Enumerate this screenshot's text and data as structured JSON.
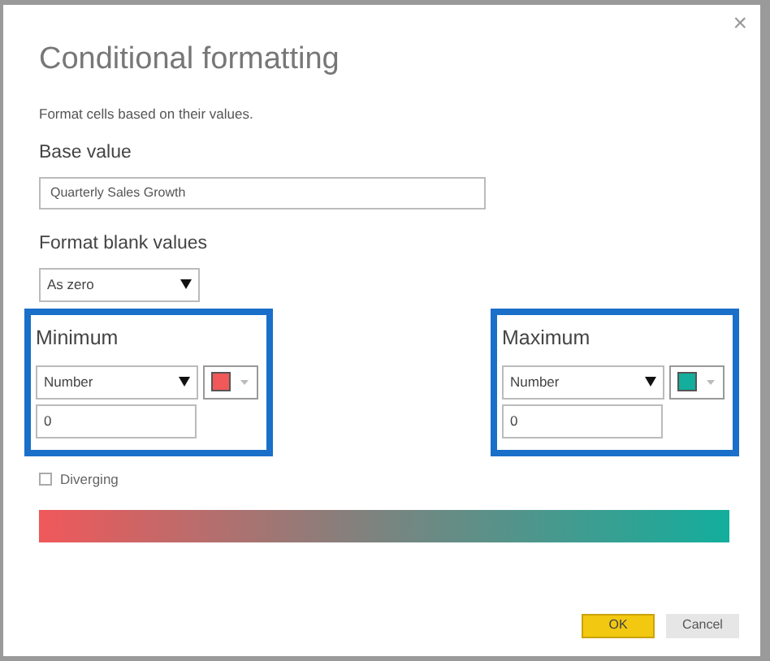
{
  "dialog": {
    "title": "Conditional formatting",
    "description": "Format cells based on their values.",
    "close": "×"
  },
  "base_value": {
    "label": "Base value",
    "value": "Quarterly Sales Growth"
  },
  "blank_values": {
    "label": "Format blank values",
    "value": "As zero"
  },
  "minimum": {
    "label": "Minimum",
    "type": "Number",
    "color": "#f0585a",
    "value": "0"
  },
  "maximum": {
    "label": "Maximum",
    "type": "Number",
    "color": "#13ae9c",
    "value": "0"
  },
  "diverging": {
    "label": "Diverging",
    "checked": false
  },
  "buttons": {
    "ok": "OK",
    "cancel": "Cancel"
  }
}
